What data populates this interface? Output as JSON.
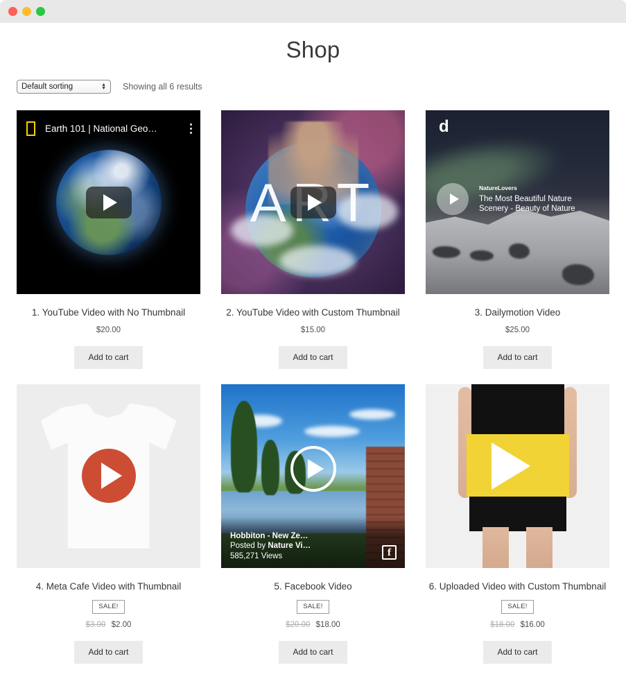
{
  "window": {
    "controls": {
      "close": "close",
      "minimize": "minimize",
      "maximize": "maximize"
    }
  },
  "header": {
    "title": "Shop"
  },
  "toolbar": {
    "sorting_value": "Default sorting",
    "results_text": "Showing all 6 results"
  },
  "products": [
    {
      "title": "1. YouTube Video with No Thumbnail",
      "price": "$20.00",
      "on_sale": false,
      "sale_label": "",
      "old_price": "",
      "add_label": "Add to cart",
      "thumb": {
        "kind": "youtube-dark",
        "bar_title": "Earth 101 | National Geo…",
        "logo": "national-geographic-logo",
        "play": "youtube-play-icon"
      }
    },
    {
      "title": "2. YouTube Video with Custom Thumbnail",
      "price": "$15.00",
      "on_sale": false,
      "sale_label": "",
      "old_price": "",
      "add_label": "Add to cart",
      "thumb": {
        "kind": "art-cosmic",
        "artwork_word": "ART",
        "play": "youtube-play-icon"
      }
    },
    {
      "title": "3. Dailymotion Video",
      "price": "$25.00",
      "on_sale": false,
      "sale_label": "",
      "old_price": "",
      "add_label": "Add to cart",
      "thumb": {
        "kind": "dailymotion",
        "logo": "d",
        "channel": "NatureLovers",
        "video_title": "The Most Beautiful Nature Scenery - Beauty of Nature",
        "play": "dailymotion-play-icon"
      }
    },
    {
      "title": "4. Meta Cafe Video with Thumbnail",
      "price": "$2.00",
      "on_sale": true,
      "sale_label": "SALE!",
      "old_price": "$3.00",
      "add_label": "Add to cart",
      "thumb": {
        "kind": "tshirt",
        "play": "red-circle-play-icon"
      }
    },
    {
      "title": "5. Facebook Video",
      "price": "$18.00",
      "on_sale": true,
      "sale_label": "SALE!",
      "old_price": "$20.00",
      "add_label": "Add to cart",
      "thumb": {
        "kind": "facebook",
        "caption_line1": "Hobbiton - New Ze…",
        "caption_line2_prefix": "Posted by ",
        "caption_line2_name": "Nature Vi…",
        "caption_line3": "585,271 Views",
        "badge": "f",
        "play": "circle-play-icon"
      }
    },
    {
      "title": "6. Uploaded Video with Custom Thumbnail",
      "price": "$16.00",
      "on_sale": true,
      "sale_label": "SALE!",
      "old_price": "$18.00",
      "add_label": "Add to cart",
      "thumb": {
        "kind": "skirt",
        "play": "white-play-icon"
      }
    }
  ],
  "colors": {
    "titlebar": "#e8e8e8",
    "close": "#ff5f57",
    "minimize": "#febc2e",
    "maximize": "#28c840",
    "page_bg": "#ffffff",
    "button_bg": "#ebebeb",
    "text": "#33373b",
    "muted": "#adadad",
    "nat_geo_yellow": "#ffcf01",
    "tee_play_red": "#cc4d34",
    "skirt_yellow": "#f2d335"
  }
}
